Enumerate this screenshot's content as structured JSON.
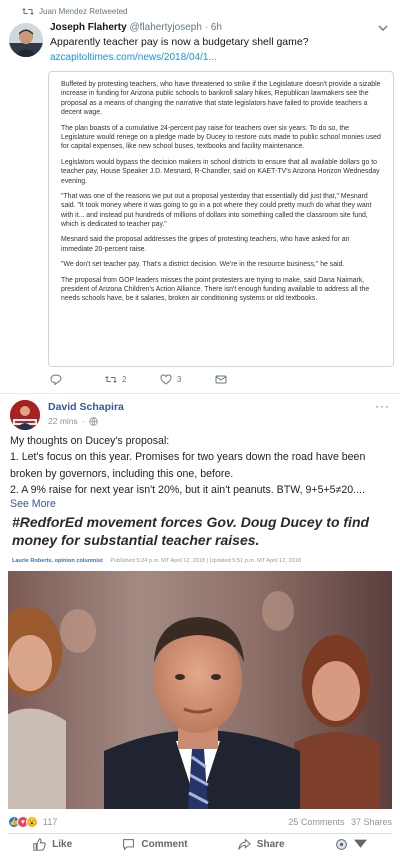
{
  "tweet": {
    "retweet_label": "Juan Mendez Retweeted",
    "author_name": "Joseph Flaherty",
    "author_handle": "@flahertyjoseph",
    "time": "6h",
    "text": "Apparently teacher pay is now a budgetary shell game?",
    "link": "azcapitoltimes.com/news/2018/04/1...",
    "quote_paragraphs": [
      "Buffeted by protesting teachers, who have threatened to strike if the Legislature doesn't provide a sizable increase in funding for Arizona public schools to bankroll salary hikes, Republican lawmakers see the proposal as a means of changing the narrative that state legislators have failed to provide teachers a decent wage.",
      "The plan boasts of a cumulative 24-percent pay raise for teachers over six years. To do so, the Legislature would renege on a pledge made by Ducey to restore cuts made to public school monies used for capital expenses, like new school buses, textbooks and facility maintenance.",
      "Legislators would bypass the decision makers in school districts to ensure that all available dollars go to teacher pay, House Speaker J.D. Mesnard, R-Chandler, said on KAET-TV's Arizona Horizon Wednesday evening.",
      "\"That was one of the reasons we put out a proposal yesterday that essentially did just that,\" Mesnard said. \"It took money where it was going to go in a pot where they could pretty much do what they want with it... and instead put hundreds of millions of dollars into something called the classroom site fund, which is dedicated to teacher pay.\"",
      "Mesnard said the proposal addresses the gripes of protesting teachers, who have asked for an immediate 20-percent raise.",
      "\"We don't set teacher pay. That's a district decision. We're in the resource business,\" he said.",
      "The proposal from GOP leaders misses the point protesters are trying to make, said Dana Naimark, president of Arizona Children's Action Alliance. There isn't enough funding available to address all the needs schools have, be it salaries, broken air conditioning systems or old textbooks."
    ],
    "retweet_count": "2",
    "like_count": "3"
  },
  "fb": {
    "author_name": "David Schapira",
    "time": "22 mins",
    "more_label": "···",
    "lines": [
      "My thoughts on Ducey's proposal:",
      "1. Let's focus on this year. Promises for two years down the road have been",
      "broken by governors, including this one, before.",
      "2. A 9% raise for next year isn't 20%, but it ain't peanuts. BTW, 9+5+5≠20...."
    ],
    "see_more": "See More",
    "article": {
      "headline": "#RedforEd movement forces Gov. Doug Ducey to find money for substantial teacher raises.",
      "byline_author": "Laurie Roberts, opinion columnist",
      "byline_meta": "Published 5:24 p.m. MT April 12, 2018 | Updated 5:51 p.m. MT April 12, 2018"
    },
    "reaction_count": "117",
    "comments": "25 Comments",
    "shares": "37 Shares",
    "actions": {
      "like": "Like",
      "comment": "Comment",
      "share": "Share"
    },
    "colors": {
      "name": "#365899",
      "like_blue": "#1877f2",
      "love_red": "#f33e58"
    }
  }
}
